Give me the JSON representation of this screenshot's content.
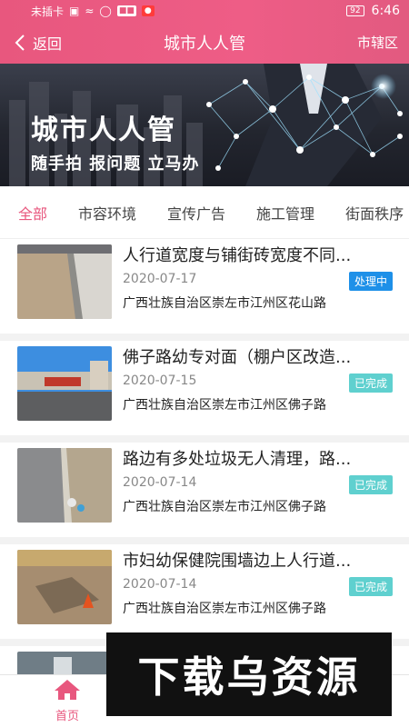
{
  "status_bar": {
    "carrier": "未插卡",
    "time": "6:46",
    "battery": "92"
  },
  "nav": {
    "back_label": "返回",
    "title": "城市人人管",
    "right_label": "市辖区"
  },
  "banner": {
    "title": "城市人人管",
    "subtitle": "随手拍 报问题 立马办"
  },
  "tabs": [
    {
      "label": "全部",
      "active": true
    },
    {
      "label": "市容环境"
    },
    {
      "label": "宣传广告"
    },
    {
      "label": "施工管理"
    },
    {
      "label": "街面秩序"
    }
  ],
  "items": [
    {
      "title": "人行道宽度与铺街砖宽度不同...",
      "date": "2020-07-17",
      "status": "处理中",
      "status_color": "#1e90e8",
      "address": "广西壮族自治区崇左市江州区花山路"
    },
    {
      "title": "佛子路幼专对面（棚户区改造...",
      "date": "2020-07-15",
      "status": "已完成",
      "status_color": "#5fd0cf",
      "address": "广西壮族自治区崇左市江州区佛子路"
    },
    {
      "title": "路边有多处垃圾无人清理，路...",
      "date": "2020-07-14",
      "status": "已完成",
      "status_color": "#5fd0cf",
      "address": "广西壮族自治区崇左市江州区佛子路"
    },
    {
      "title": "市妇幼保健院围墙边上人行道...",
      "date": "2020-07-14",
      "status": "已完成",
      "status_color": "#5fd0cf",
      "address": "广西壮族自治区崇左市江州区佛子路"
    }
  ],
  "bottom_nav": {
    "home_label": "首页"
  },
  "watermark": {
    "text": "下载乌资源"
  },
  "colors": {
    "brand": "#e8577e",
    "processing": "#1e90e8",
    "completed": "#5fd0cf"
  }
}
